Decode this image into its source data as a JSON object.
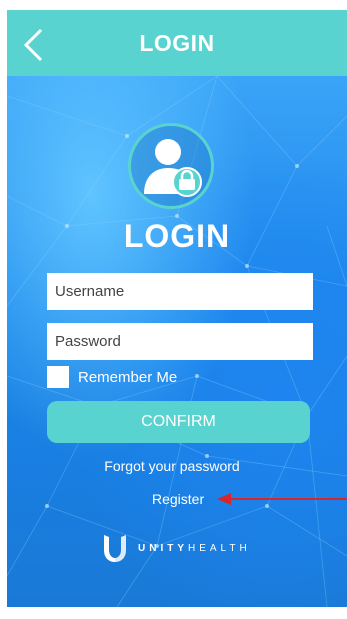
{
  "header": {
    "title": "LOGIN",
    "back_icon": "chevron-left-icon"
  },
  "login": {
    "avatar_icon": "user-lock-icon",
    "heading": "LOGIN",
    "username_placeholder": "Username",
    "password_placeholder": "Password",
    "remember_label": "Remember Me",
    "confirm_label": "CONFIRM",
    "forgot_label": "Forgot your password",
    "register_label": "Register"
  },
  "brand": {
    "name_bold": "UNITY",
    "name_light": "HEALTH",
    "logo_icon": "unityhealth-logo-icon"
  },
  "annotation": {
    "arrow_icon": "red-arrow-icon"
  },
  "colors": {
    "accent": "#59d3cf",
    "background_blue": "#1e88ec",
    "arrow": "#d8262b"
  }
}
